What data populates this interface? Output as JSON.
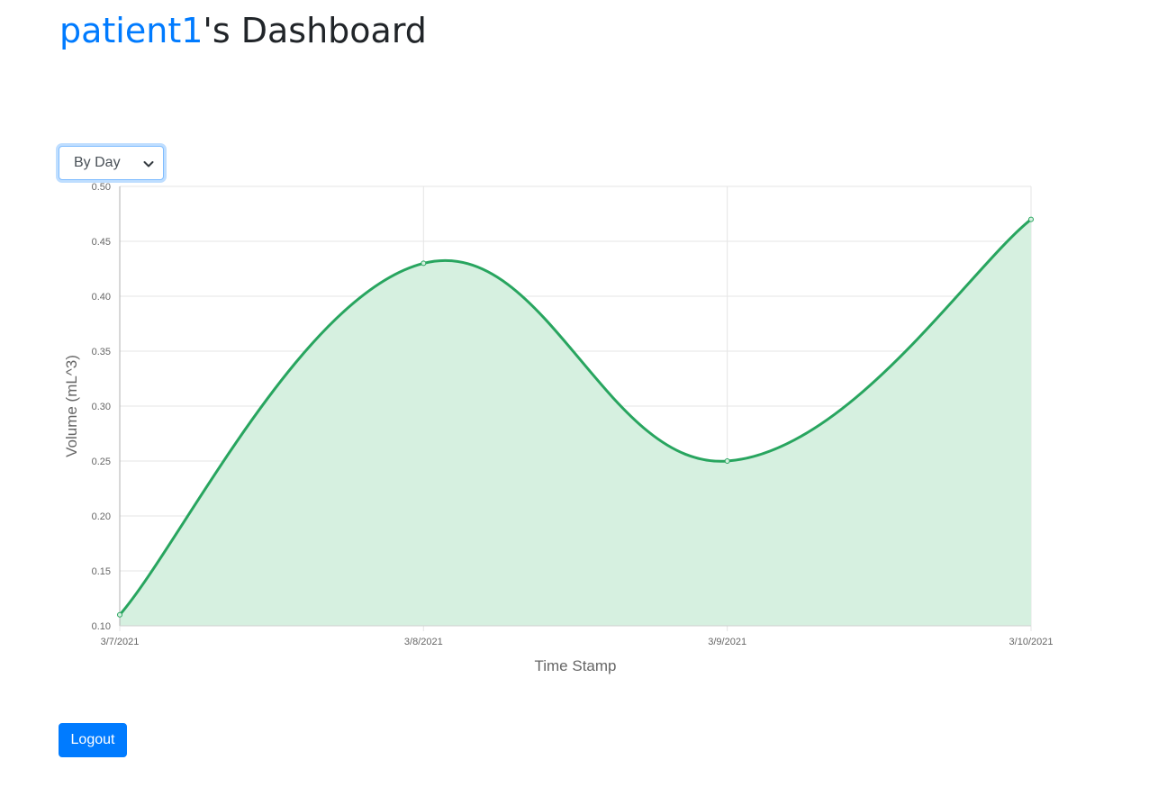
{
  "header": {
    "username": "patient1",
    "title_suffix": "'s Dashboard"
  },
  "range_select": {
    "selected": "By Day",
    "icon": "chevron-down-icon"
  },
  "chart_data": {
    "type": "area",
    "categories": [
      "3/7/2021",
      "3/8/2021",
      "3/9/2021",
      "3/10/2021"
    ],
    "series": [
      {
        "values": [
          0.11,
          0.43,
          0.25,
          0.47
        ]
      }
    ],
    "xlabel": "Time Stamp",
    "ylabel": "Volume (mL^3)",
    "ylim": [
      0.1,
      0.5
    ],
    "yticks": [
      "0.10",
      "0.15",
      "0.20",
      "0.25",
      "0.30",
      "0.35",
      "0.40",
      "0.45",
      "0.50"
    ],
    "grid": true,
    "line_color": "#28a55f",
    "fill_color": "#d6f0e0"
  },
  "footer": {
    "logout_label": "Logout"
  },
  "colors": {
    "primary": "#007bff",
    "heading": "#212529"
  }
}
